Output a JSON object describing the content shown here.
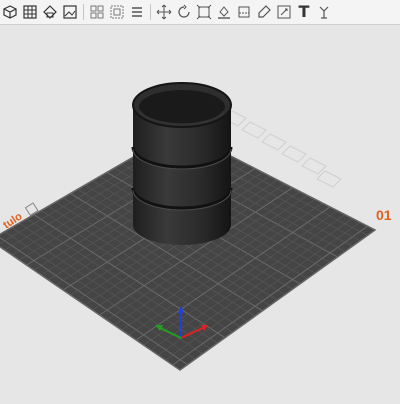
{
  "toolbar": {
    "items": [
      {
        "icon": "cube-view-icon"
      },
      {
        "icon": "grid-icon"
      },
      {
        "icon": "transform-icon"
      },
      {
        "icon": "image-icon"
      },
      {
        "icon": "group-icon"
      },
      {
        "icon": "ungroup-icon"
      },
      {
        "icon": "list-icon"
      },
      {
        "icon": "move-icon"
      },
      {
        "icon": "rotate-icon"
      },
      {
        "icon": "scale-icon"
      },
      {
        "icon": "lay-flat-icon"
      },
      {
        "icon": "cut-icon"
      },
      {
        "icon": "paint-icon"
      },
      {
        "icon": "measure-icon"
      },
      {
        "icon": "text-icon",
        "text": "T"
      },
      {
        "icon": "support-icon"
      }
    ]
  },
  "viewport": {
    "bed_left_label": "tulo",
    "bed_right_label": "01",
    "bed_color": "#454545",
    "object_color": "#2b2b2b",
    "object_text": "",
    "accent_color": "#e0621f",
    "axes": {
      "x_color": "#e02020",
      "y_color": "#20a020",
      "z_color": "#2040e0"
    }
  }
}
